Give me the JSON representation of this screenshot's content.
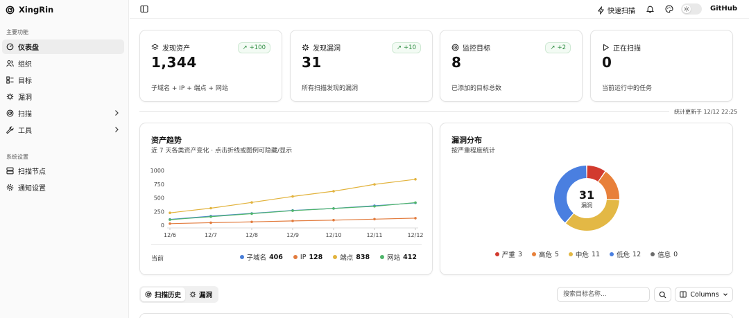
{
  "app": {
    "name": "XingRin"
  },
  "sidebar": {
    "main_group_label": "主要功能",
    "main_items": [
      {
        "label": "仪表盘",
        "icon": "dashboard-icon",
        "active": true
      },
      {
        "label": "组织",
        "icon": "users-icon"
      },
      {
        "label": "目标",
        "icon": "target-list-icon"
      },
      {
        "label": "漏洞",
        "icon": "bug-icon"
      },
      {
        "label": "扫描",
        "icon": "radar-icon",
        "expandable": true
      },
      {
        "label": "工具",
        "icon": "wrench-icon",
        "expandable": true
      }
    ],
    "settings_group_label": "系统设置",
    "settings_items": [
      {
        "label": "扫描节点",
        "icon": "server-icon"
      },
      {
        "label": "通知设置",
        "icon": "gear-icon"
      }
    ]
  },
  "topbar": {
    "quick_scan_label": "快速扫描",
    "github_label": "GitHub",
    "theme_toggle": "light"
  },
  "stats": [
    {
      "label": "发现资产",
      "icon": "layers-icon",
      "value": "1,344",
      "badge": "+100",
      "desc": "子域名 + IP + 端点 + 网站"
    },
    {
      "label": "发现漏洞",
      "icon": "bug-icon",
      "value": "31",
      "badge": "+10",
      "desc": "所有扫描发现的漏洞"
    },
    {
      "label": "监控目标",
      "icon": "target-icon",
      "value": "8",
      "badge": "+2",
      "desc": "已添加的目标总数"
    },
    {
      "label": "正在扫描",
      "icon": "play-icon",
      "value": "0",
      "badge": "",
      "desc": "当前运行中的任务"
    }
  ],
  "updated_text": "统计更新于 12/12 22:25",
  "asset_trend": {
    "title": "资产趋势",
    "subtitle": "近 7 天各类资产变化 · 点击折线或图例可隐藏/显示",
    "footer_label": "当前",
    "chart_data": {
      "type": "line",
      "x": [
        "12/6",
        "12/7",
        "12/8",
        "12/9",
        "12/10",
        "12/11",
        "12/12"
      ],
      "ylim": [
        0,
        1000
      ],
      "yticks": [
        0,
        250,
        500,
        750,
        1000
      ],
      "grid": false,
      "legend_position": "bottom-right",
      "series": [
        {
          "name": "子域名",
          "color": "#4a7fd8",
          "values": [
            105,
            165,
            215,
            270,
            305,
            355,
            406
          ],
          "current": 406
        },
        {
          "name": "IP",
          "color": "#e27b3d",
          "values": [
            28,
            45,
            60,
            78,
            92,
            110,
            128
          ],
          "current": 128
        },
        {
          "name": "端点",
          "color": "#e2b33d",
          "values": [
            225,
            310,
            415,
            525,
            620,
            745,
            838
          ],
          "current": 838
        },
        {
          "name": "网站",
          "color": "#4fb56a",
          "values": [
            100,
            155,
            210,
            265,
            305,
            345,
            412
          ],
          "current": 412
        }
      ]
    }
  },
  "vuln_dist": {
    "title": "漏洞分布",
    "subtitle": "按严重程度统计",
    "total": "31",
    "center_label": "漏洞",
    "chart_data": {
      "type": "pie",
      "donut": true,
      "slices": [
        {
          "name": "严重",
          "value": 3,
          "color": "#d23a2e"
        },
        {
          "name": "高危",
          "value": 5,
          "color": "#e8803a"
        },
        {
          "name": "中危",
          "value": 11,
          "color": "#e3b845"
        },
        {
          "name": "低危",
          "value": 12,
          "color": "#4a7fe0"
        },
        {
          "name": "信息",
          "value": 0,
          "color": "#6b6b6b"
        }
      ]
    }
  },
  "bottom": {
    "tabs": [
      {
        "label": "扫描历史",
        "icon": "radar-icon",
        "active": true
      },
      {
        "label": "漏洞",
        "icon": "bug-icon"
      }
    ],
    "search_placeholder": "搜索目标名称...",
    "columns_label": "Columns"
  }
}
